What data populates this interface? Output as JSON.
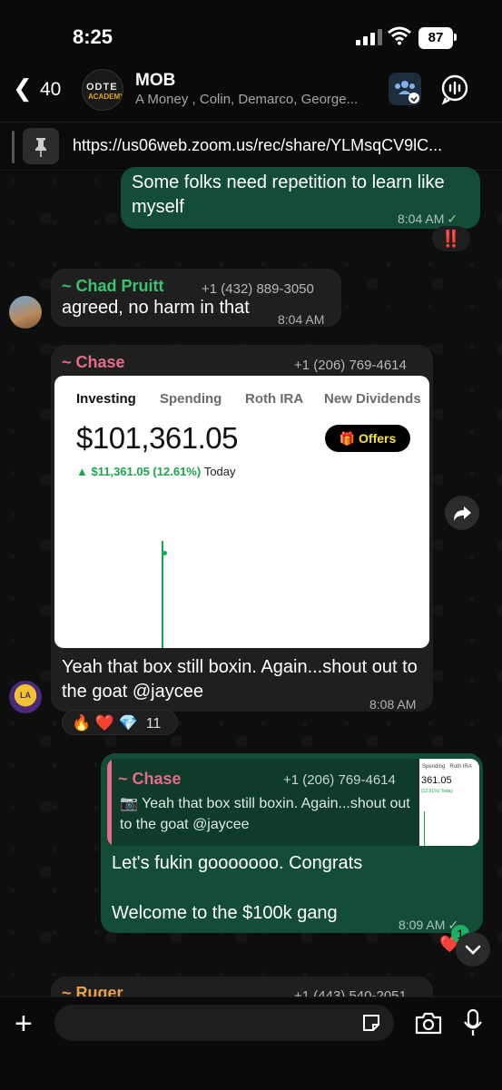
{
  "status": {
    "time": "8:25",
    "battery": "87"
  },
  "header": {
    "back_count": "40",
    "group_avatar_line1": "ODTE",
    "group_avatar_line2": "ACADEMY",
    "title": "MOB",
    "subtitle": "A Money , Colin, Demarco, George..."
  },
  "pinned": {
    "text": "https://us06web.zoom.us/rec/share/YLMsqCV9lC..."
  },
  "messages": [
    {
      "type": "outgoing",
      "text": "Some folks need repetition to learn like myself",
      "time": "8:04 AM",
      "reaction": "‼️"
    },
    {
      "type": "incoming",
      "sender": "~ Chad Pruitt",
      "phone": "+1 (432) 889-3050",
      "text": "agreed, no harm in that",
      "time": "8:04 AM"
    },
    {
      "type": "incoming",
      "sender": "~ Chase",
      "phone": "+1 (206) 769-4614",
      "image": {
        "tabs": [
          "Investing",
          "Spending",
          "Roth IRA",
          "New Dividends"
        ],
        "balance": "$101,361.05",
        "change_amount": "▲ $11,361.05 (12.61%)",
        "change_period": "Today",
        "offers_label": "Offers"
      },
      "text": "Yeah that box still boxin. Again...shout out to the goat @jaycee",
      "time": "8:08 AM",
      "reactions": {
        "emojis": "🔥 ❤️ 💎",
        "count": "11"
      }
    },
    {
      "type": "outgoing",
      "reply": {
        "sender": "~ Chase",
        "phone": "+1 (206) 769-4614",
        "text": "Yeah that box still boxin. Again...shout out to the goat @jaycee",
        "thumb_tabs": "Spending   Roth IRA",
        "thumb_value": "361.05",
        "thumb_change": "(12.61%) Today"
      },
      "line1": "Let's fukin gooooooo. Congrats",
      "line2": "Welcome to the $100k gang",
      "time": "8:09 AM",
      "reaction_count": "1"
    },
    {
      "type": "incoming",
      "sender": "~ Ruger",
      "phone": "+1 (443) 540-2051"
    }
  ],
  "composer": {
    "placeholder": ""
  },
  "colors": {
    "outgoing": "#144d37",
    "incoming": "#1f1f1f",
    "accent_green": "#20b062",
    "chase_pink": "#e56b8a",
    "chad_green": "#3cc36f",
    "ruger_orange": "#e8a04a"
  }
}
